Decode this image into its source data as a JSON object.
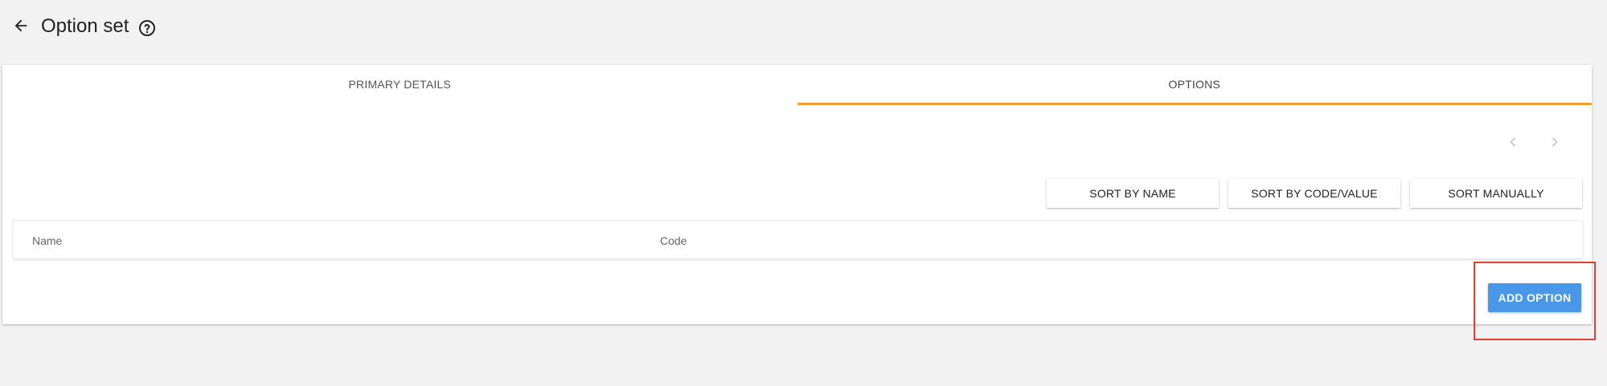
{
  "header": {
    "back_icon": "arrow-back-icon",
    "title": "Option set",
    "help_icon": "help-circle-icon"
  },
  "tabs": [
    {
      "label": "PRIMARY DETAILS",
      "active": false
    },
    {
      "label": "OPTIONS",
      "active": true
    }
  ],
  "pager": {
    "prev_icon": "chevron-left-icon",
    "next_icon": "chevron-right-icon"
  },
  "sort_buttons": {
    "by_name": "SORT BY NAME",
    "by_code": "SORT BY CODE/VALUE",
    "manually": "SORT MANUALLY"
  },
  "table": {
    "columns": [
      "Name",
      "Code"
    ],
    "rows": []
  },
  "actions": {
    "add_option": "ADD OPTION"
  },
  "colors": {
    "accent_tab": "#f1a033",
    "primary_button": "#4a97e8",
    "highlight_box": "#e0402f",
    "background": "#f2f2f2"
  }
}
